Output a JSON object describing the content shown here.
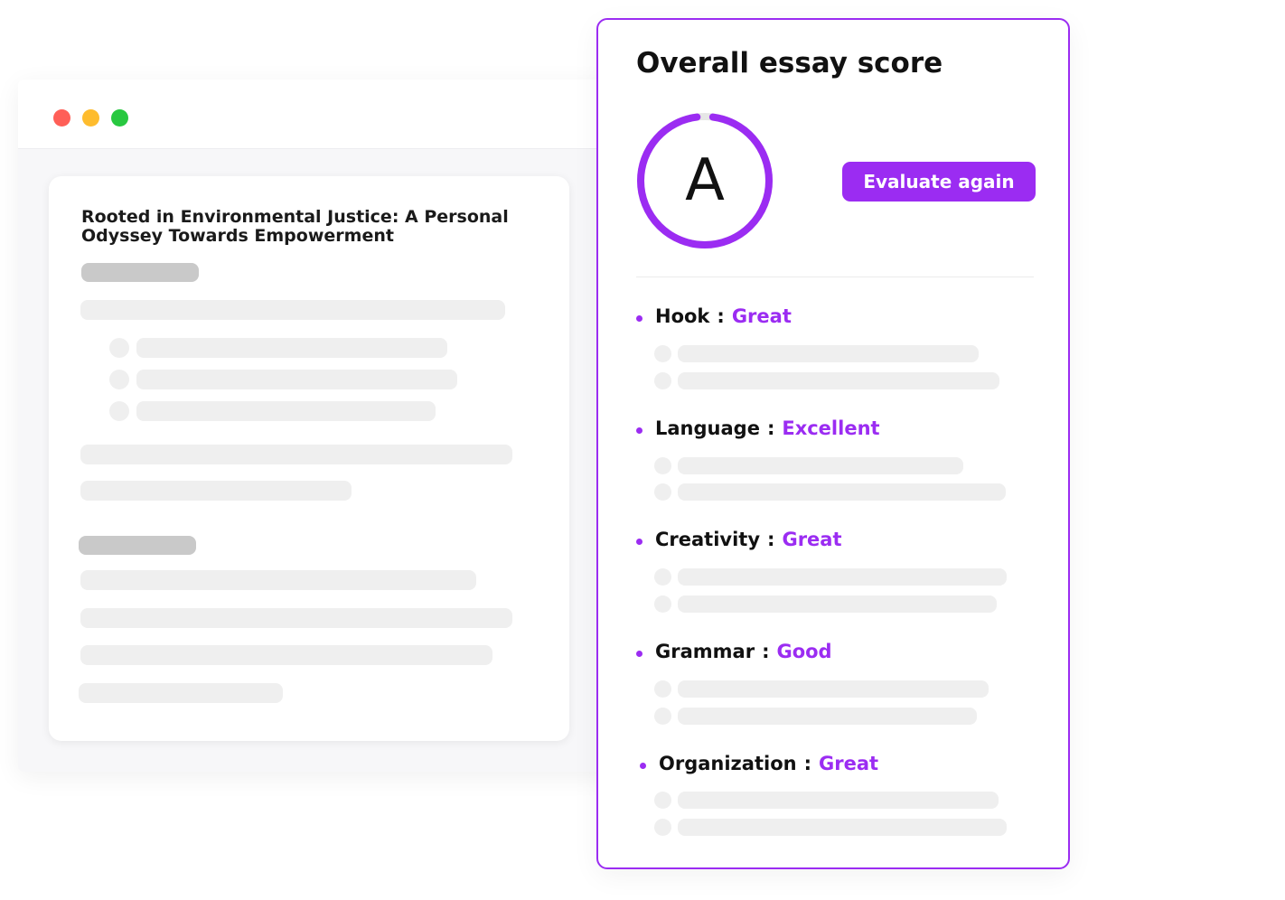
{
  "window": {
    "controls": [
      {
        "name": "close",
        "color": "#ff5f57"
      },
      {
        "name": "minimize",
        "color": "#febc2e"
      },
      {
        "name": "maximize",
        "color": "#28c840"
      }
    ]
  },
  "essay": {
    "title": "Rooted in Environmental Justice: A Personal Odyssey Towards Empowerment"
  },
  "score_panel": {
    "title": "Overall essay score",
    "grade": "A",
    "grade_progress": 0.96,
    "evaluate_button": "Evaluate again",
    "accent_color": "#9b2cf2",
    "criteria": [
      {
        "name": "Hook",
        "separator": ":",
        "rating": "Great"
      },
      {
        "name": "Language",
        "separator": ":",
        "rating": "Excellent"
      },
      {
        "name": "Creativity",
        "separator": ":",
        "rating": "Great"
      },
      {
        "name": "Grammar",
        "separator": ":",
        "rating": "Good"
      },
      {
        "name": "Organization",
        "separator": ":",
        "rating": "Great"
      }
    ]
  }
}
